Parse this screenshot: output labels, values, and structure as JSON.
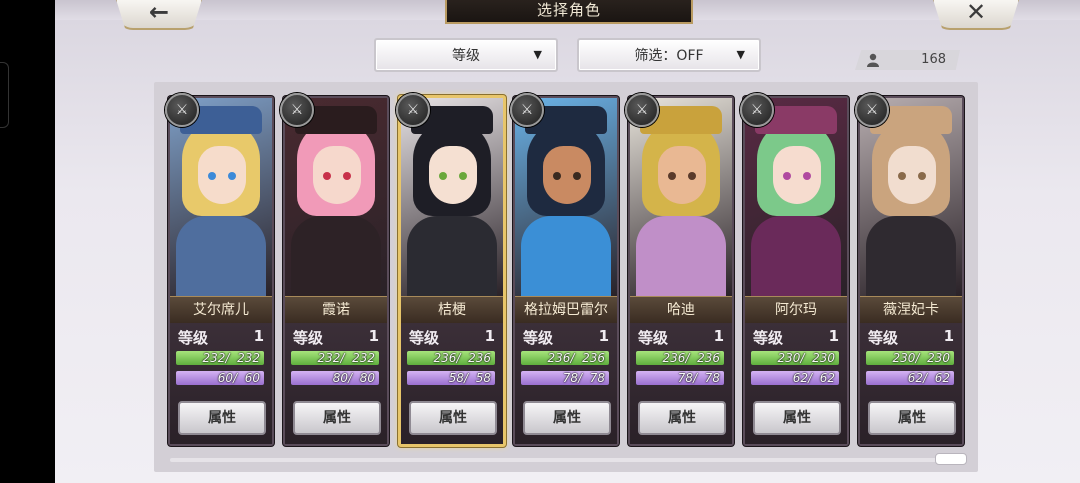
{
  "header": {
    "title": "选择角色",
    "back_icon": "←",
    "close_icon": "✕"
  },
  "toolbar": {
    "sort_label": "等级",
    "filter_label": "筛选：OFF",
    "dropdown_arrow": "▼",
    "count": "168"
  },
  "cards": [
    {
      "name": "艾尔席儿",
      "level_label": "等级",
      "level": "1",
      "hp": "232/  232",
      "mp": "60/  60",
      "attr_label": "属性",
      "weapon": "⚔",
      "colors": {
        "bg": "#7fa0c8",
        "hair": "#e8c96a",
        "face": "#f6dccb",
        "eye": "#3c8ad8",
        "body": "#4f6e9e",
        "hat": "#3d5f96"
      }
    },
    {
      "name": "霞诺",
      "level_label": "等级",
      "level": "1",
      "hp": "232/  232",
      "mp": "80/  80",
      "attr_label": "属性",
      "weapon": "⚔",
      "colors": {
        "bg": "#4a2a30",
        "hair": "#f19ab8",
        "face": "#f6d8cc",
        "eye": "#c8304a",
        "body": "#2d2226",
        "hat": "#2a1c1e"
      }
    },
    {
      "name": "桔梗",
      "level_label": "等级",
      "level": "1",
      "hp": "236/  236",
      "mp": "58/  58",
      "attr_label": "属性",
      "weapon": "⚔",
      "colors": {
        "bg": "#e8e4e6",
        "hair": "#1e1e26",
        "face": "#f5e0d2",
        "eye": "#6aa83c",
        "body": "#2b2b32",
        "hat": "#1e1e26"
      }
    },
    {
      "name": "格拉姆巴雷尔",
      "level_label": "等级",
      "level": "1",
      "hp": "236/  236",
      "mp": "78/  78",
      "attr_label": "属性",
      "weapon": "⚔",
      "colors": {
        "bg": "#6bb3e8",
        "hair": "#1e2a40",
        "face": "#c98a62",
        "eye": "#3a2a20",
        "body": "#3b8fd6",
        "hat": "#1e2a40"
      }
    },
    {
      "name": "哈迪",
      "level_label": "等级",
      "level": "1",
      "hp": "236/  236",
      "mp": "78/  78",
      "attr_label": "属性",
      "weapon": "⚔",
      "colors": {
        "bg": "#e9e5dc",
        "hair": "#d4b44a",
        "face": "#e9b893",
        "eye": "#5a3a2a",
        "body": "#c08fc8",
        "hat": "#c9a23c"
      }
    },
    {
      "name": "阿尔玛",
      "level_label": "等级",
      "level": "1",
      "hp": "230/  230",
      "mp": "62/  62",
      "attr_label": "属性",
      "weapon": "⚔",
      "colors": {
        "bg": "#5a2a44",
        "hair": "#7cc98a",
        "face": "#f6dccf",
        "eye": "#b04aa0",
        "body": "#6a2a5a",
        "hat": "#8a3a66"
      }
    },
    {
      "name": "薇涅妃卡",
      "level_label": "等级",
      "level": "1",
      "hp": "230/  230",
      "mp": "62/  62",
      "attr_label": "属性",
      "weapon": "⚔",
      "colors": {
        "bg": "#b8aeb0",
        "hair": "#caa47e",
        "face": "#f1ddcf",
        "eye": "#8a6a4a",
        "body": "#2f2a30",
        "hat": "#caa47e"
      }
    }
  ]
}
